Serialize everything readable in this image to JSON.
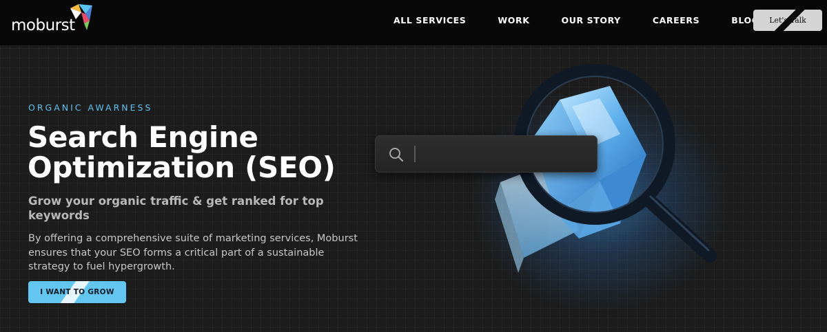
{
  "brand": {
    "name": "moburst",
    "colors": {
      "accent": "#5fc1ee",
      "cta": "#62c6f1",
      "nav_bg": "#080808"
    }
  },
  "nav": {
    "links": [
      "ALL SERVICES",
      "WORK",
      "OUR STORY",
      "CAREERS",
      "BLOG"
    ],
    "cta_label": "Let's Talk"
  },
  "hero": {
    "eyebrow": "ORGANIC AWARNESS",
    "title_line1": "Search Engine",
    "title_line2": "Optimization (SEO)",
    "subtitle": "Grow your organic traffic & get ranked for top keywords",
    "body": "By offering a comprehensive suite of marketing services, Moburst ensures that your SEO forms a critical part of a sustainable strategy to fuel hypergrowth.",
    "cta_label": "I WANT TO GROW"
  },
  "illustration": {
    "search_placeholder": "",
    "icons": [
      "search-icon",
      "magnifying-glass-icon",
      "crystal-cube-icon"
    ]
  }
}
